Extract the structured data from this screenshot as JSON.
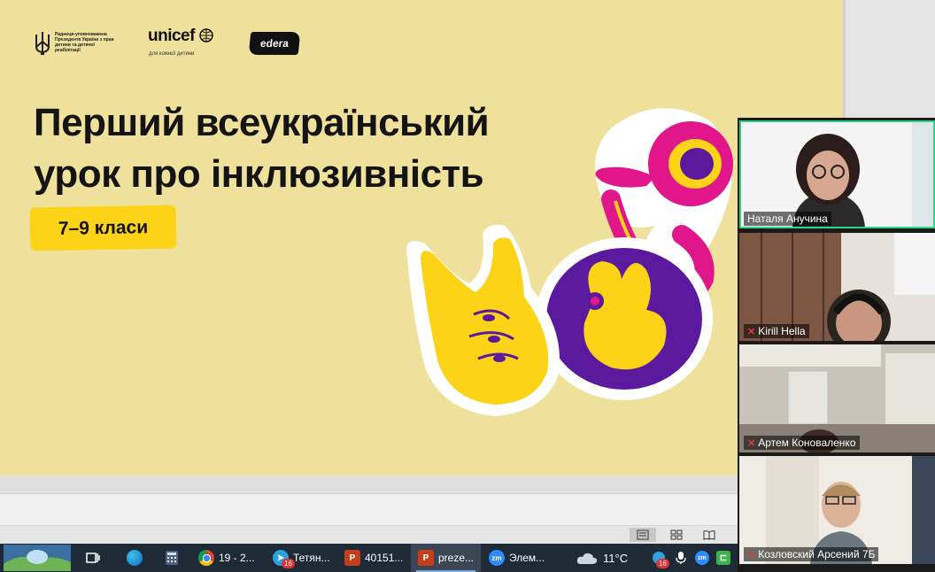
{
  "slide": {
    "logo_gov_text": "Радниця-уповноважена Президента України з прав дитини та дитячої реабілітації",
    "logo_unicef": "unicef",
    "logo_unicef_sub": "для кожної дитини",
    "logo_edera": "edera",
    "title_line1": "Перший всеукраїнський",
    "title_line2": "урок про інклюзивність",
    "grade_badge": "7–9 класи"
  },
  "colors": {
    "slide_bg": "#efe09c",
    "badge": "#fcd317",
    "accent_purple": "#5b1a9e",
    "accent_magenta": "#e0168a",
    "active_speaker": "#2fd48b"
  },
  "video_panel": {
    "participants": [
      {
        "name": "Наталя Анучина",
        "muted": false,
        "active": true
      },
      {
        "name": "Kirill Hella",
        "muted": true,
        "active": false
      },
      {
        "name": "Артем Коноваленко",
        "muted": true,
        "active": false
      },
      {
        "name": "Козловский Арсений 7Б",
        "muted": true,
        "active": false
      }
    ]
  },
  "taskbar": {
    "items": [
      {
        "label": "19 - 2...",
        "icon": "chrome-icon"
      },
      {
        "label": "Тетян...",
        "icon": "telegram-icon",
        "badge": "16"
      },
      {
        "label": "40151...",
        "icon": "powerpoint-icon"
      },
      {
        "label": "preze...",
        "icon": "powerpoint-icon"
      },
      {
        "label": "Элем...",
        "icon": "zoom-icon"
      }
    ],
    "zm_label": "zm",
    "weather": "11°C",
    "tray_badge": "16",
    "tray_zm": "zm"
  }
}
